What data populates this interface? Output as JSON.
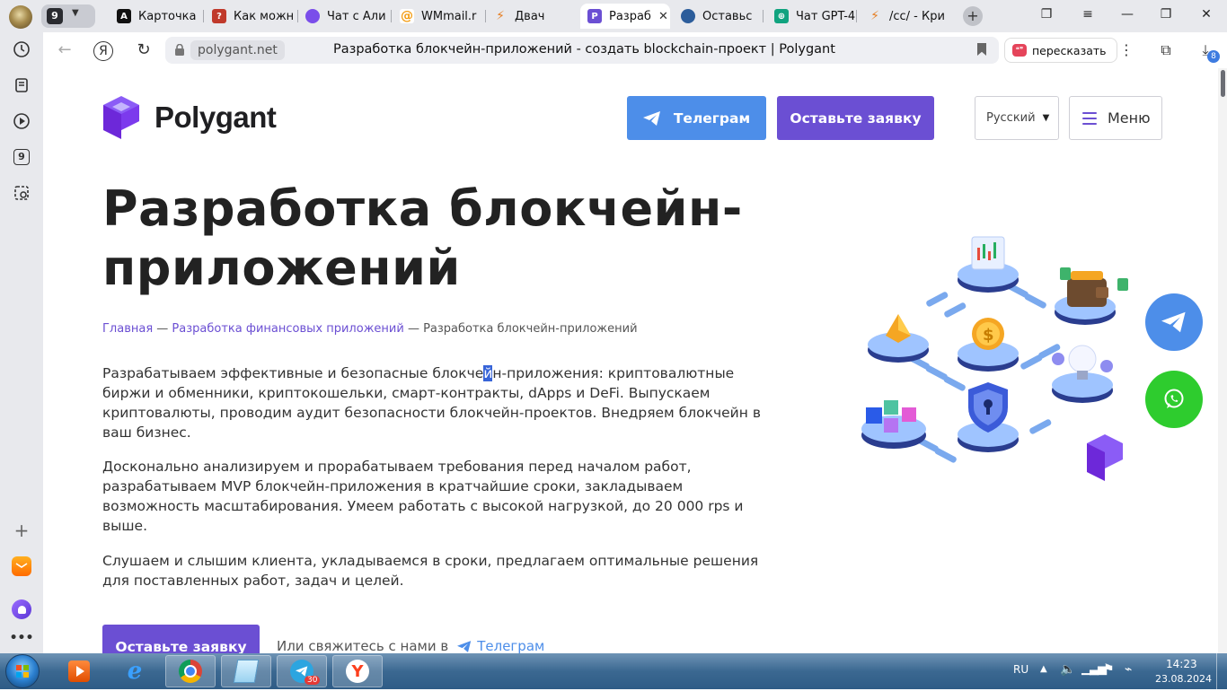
{
  "browser": {
    "tab_group_count": "9",
    "tabs": [
      {
        "title": "Карточка",
        "favicon_text": "A",
        "favicon_color": "#111111"
      },
      {
        "title": "Как можн",
        "favicon_text": "?",
        "favicon_color": "#c0392b"
      },
      {
        "title": "Чат с Али",
        "favicon_text": "",
        "favicon_color": "#7a4dea"
      },
      {
        "title": "WMmail.r",
        "favicon_text": "@",
        "favicon_color": "#f39c12"
      },
      {
        "title": "Двач",
        "favicon_text": "⚡",
        "favicon_color": "#e67e22"
      },
      {
        "title": "Разраб",
        "favicon_text": "P",
        "favicon_color": "#6b4fd3"
      },
      {
        "title": "Оставьс",
        "favicon_text": "",
        "favicon_color": "#2c5d9b"
      },
      {
        "title": "Чат GPT-4",
        "favicon_text": "⊕",
        "favicon_color": "#10a37f"
      },
      {
        "title": "/cc/ - Кри",
        "favicon_text": "⚡",
        "favicon_color": "#e67e22"
      }
    ],
    "domain": "polygant.net",
    "page_title": "Разработка блокчейн-приложений - создать blockchain-проект | Polygant",
    "retell_label": "пересказать",
    "downloads_badge": "8",
    "sidebar_badge": "9"
  },
  "header": {
    "logo_text": "Polygant",
    "telegram_button": "Телеграм",
    "order_button": "Оставьте заявку",
    "language": "Русский",
    "menu_button": "Меню"
  },
  "hero": {
    "title": "Разработка блокчейн-приложений",
    "breadcrumb": {
      "home": "Главная",
      "separator": " — ",
      "parent": "Разработка финансовых приложений",
      "current": "Разработка блокчейн-приложений"
    },
    "paragraph1_before": "Разрабатываем эффективные и безопасные блокче",
    "paragraph1_selected": "й",
    "paragraph1_after": "н-приложения: криптовалютные биржи и обменники, криптокошельки, смарт-контракты, dApps и DeFi. Выпускаем криптовалюты, проводим аудит безопасности блокчейн-проектов. Внедряем блокчейн в ваш бизнес.",
    "paragraph2": "Досконально анализируем и прорабатываем требования перед началом работ, разрабатываем MVP блокчейн-приложения в кратчайшие сроки, закладываем возможность масштабирования. Умеем работать с высокой нагрузкой, до 20 000 rps и выше.",
    "paragraph3": "Слушаем и слышим клиента, укладываемся в сроки, предлагаем оптимальные решения для поставленных работ, задач и целей.",
    "cta_button": "Оставьте заявку",
    "contact_prefix": "Или свяжитесь с нами в",
    "contact_link": "Телеграм"
  },
  "taskbar": {
    "telegram_badge": "30",
    "language": "RU",
    "time": "14:23",
    "date": "23.08.2024"
  },
  "colors": {
    "brand_purple": "#6b4fd3",
    "telegram_blue": "#4d8ee9",
    "whatsapp_green": "#2ecc2e"
  }
}
